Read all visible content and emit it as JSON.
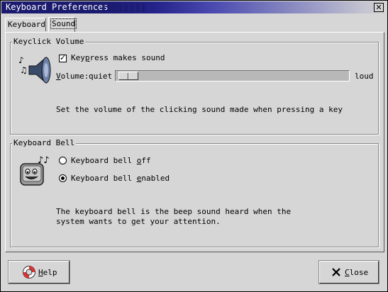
{
  "window": {
    "title": "Keyboard Preferences",
    "close_glyph": "✕"
  },
  "tabs": [
    {
      "label": "Keyboard",
      "active": false
    },
    {
      "label": "Sound",
      "active": true
    }
  ],
  "keyclick": {
    "frame_label": "Keyclick Volume",
    "checkbox_pre": "Key",
    "checkbox_u": "p",
    "checkbox_post": "ress makes sound",
    "checked": true,
    "volume_pre": "V",
    "volume_post": "olume:",
    "quiet": "quiet",
    "loud": "loud",
    "volume_level": 0.0,
    "description": "Set the volume of the clicking sound made when pressing a key",
    "icon": "speaker-icon"
  },
  "bell": {
    "frame_label": "Keyboard Bell",
    "off_pre": "Keyboard bell ",
    "off_u": "o",
    "off_post": "ff",
    "on_pre": "Keyboard bell ",
    "on_u": "e",
    "on_post": "nabled",
    "selected": "enabled",
    "description_line1": "The keyboard bell is the beep sound heard when the",
    "description_line2": "system wants to get your attention.",
    "icon": "bell-face-icon"
  },
  "buttons": {
    "help_u": "H",
    "help_rest": "elp",
    "close_u": "C",
    "close_rest": "lose",
    "help_icon": "lifebuoy-icon",
    "close_icon": "x-icon"
  },
  "colors": {
    "titlebar": "#1a1a6e",
    "background": "#d6d6d6"
  }
}
